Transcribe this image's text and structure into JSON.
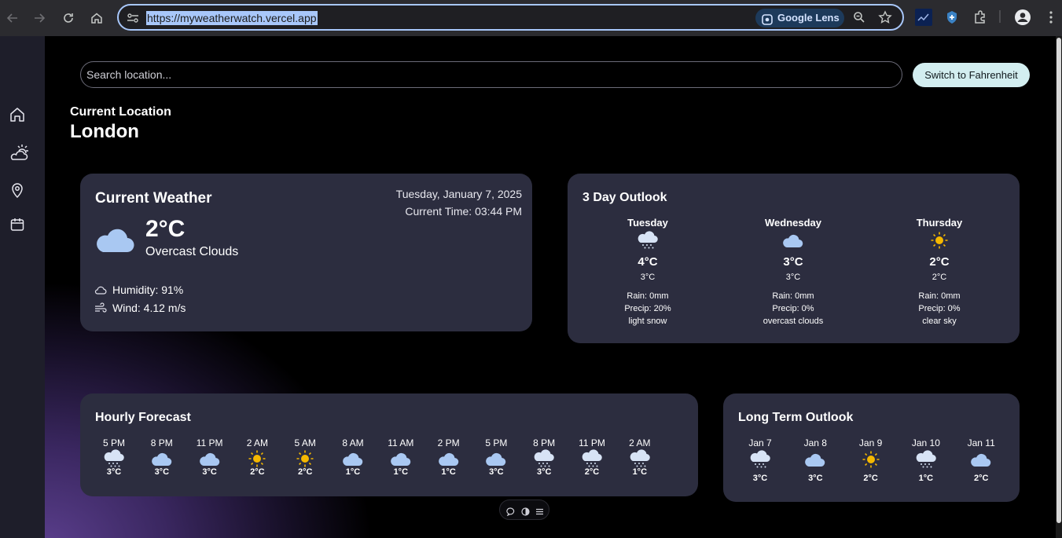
{
  "browser": {
    "url": "https://myweatherwatch.vercel.app",
    "lens_label": "Google Lens"
  },
  "search": {
    "placeholder": "Search location..."
  },
  "unit_toggle_label": "Switch to Fahrenheit",
  "location": {
    "label": "Current Location",
    "name": "London"
  },
  "current_weather": {
    "title": "Current Weather",
    "date": "Tuesday, January 7, 2025",
    "time": "Current Time: 03:44 PM",
    "temperature": "2°C",
    "description": "Overcast Clouds",
    "humidity": "Humidity: 91%",
    "wind": "Wind: 4.12 m/s",
    "icon": "cloud-icon"
  },
  "outlook": {
    "title": "3 Day Outlook",
    "days": [
      {
        "day": "Tuesday",
        "icon": "snow-cloud-icon",
        "high": "4°C",
        "low": "3°C",
        "rain": "Rain: 0mm",
        "precip": "Precip: 20%",
        "desc": "light snow"
      },
      {
        "day": "Wednesday",
        "icon": "cloud-icon",
        "high": "3°C",
        "low": "3°C",
        "rain": "Rain: 0mm",
        "precip": "Precip: 0%",
        "desc": "overcast clouds"
      },
      {
        "day": "Thursday",
        "icon": "sun-icon",
        "high": "2°C",
        "low": "2°C",
        "rain": "Rain: 0mm",
        "precip": "Precip: 0%",
        "desc": "clear sky"
      }
    ]
  },
  "hourly": {
    "title": "Hourly Forecast",
    "hours": [
      {
        "time": "5 PM",
        "icon": "snow-cloud-icon",
        "temp": "3°C"
      },
      {
        "time": "8 PM",
        "icon": "cloud-icon",
        "temp": "3°C"
      },
      {
        "time": "11 PM",
        "icon": "cloud-icon",
        "temp": "3°C"
      },
      {
        "time": "2 AM",
        "icon": "sun-icon",
        "temp": "2°C"
      },
      {
        "time": "5 AM",
        "icon": "sun-icon",
        "temp": "2°C"
      },
      {
        "time": "8 AM",
        "icon": "cloud-icon",
        "temp": "1°C"
      },
      {
        "time": "11 AM",
        "icon": "cloud-icon",
        "temp": "1°C"
      },
      {
        "time": "2 PM",
        "icon": "cloud-icon",
        "temp": "1°C"
      },
      {
        "time": "5 PM",
        "icon": "cloud-icon",
        "temp": "3°C"
      },
      {
        "time": "8 PM",
        "icon": "snow-cloud-icon",
        "temp": "3°C"
      },
      {
        "time": "11 PM",
        "icon": "snow-cloud-icon",
        "temp": "2°C"
      },
      {
        "time": "2 AM",
        "icon": "snow-cloud-icon",
        "temp": "1°C"
      }
    ]
  },
  "long_term": {
    "title": "Long Term Outlook",
    "days": [
      {
        "date": "Jan 7",
        "icon": "snow-cloud-icon",
        "temp": "3°C"
      },
      {
        "date": "Jan 8",
        "icon": "cloud-icon",
        "temp": "3°C"
      },
      {
        "date": "Jan 9",
        "icon": "sun-icon",
        "temp": "2°C"
      },
      {
        "date": "Jan 10",
        "icon": "snow-cloud-icon",
        "temp": "1°C"
      },
      {
        "date": "Jan 11",
        "icon": "cloud-icon",
        "temp": "2°C"
      }
    ]
  },
  "colors": {
    "card": "#2c2d3f",
    "cloud": "#a9c8f2",
    "sun": "#f5b800",
    "accent_button": "#d3eef0"
  }
}
